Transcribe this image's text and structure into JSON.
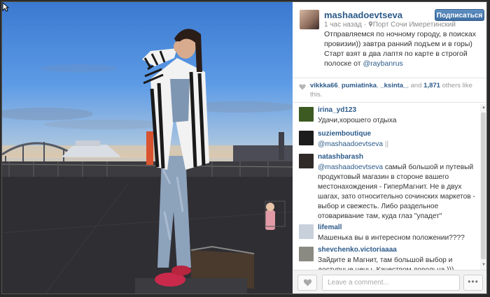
{
  "post": {
    "username": "mashaadoevtseva",
    "follow_label": "Подписаться",
    "time": "1 час назад",
    "separator": " · ",
    "location": "Порт Сочи Имеретинский",
    "caption_text": "Отправляемся по ночному городу, в поисках провизии)) завтра ранний подъем и в горы) Старт взят в два лаптя по карте в строгой полоске от ",
    "caption_mention": "@raybanrus"
  },
  "likes": {
    "users": [
      "vikkka66",
      "pumiatinka",
      "_ksinta_"
    ],
    "sep1": ", ",
    "sep2": ", ",
    "and_text": ", and ",
    "count": "1,871",
    "suffix": " others like this."
  },
  "comments": [
    {
      "user": "irina_yd123",
      "mention": "",
      "text": "Удачи,хорошего отдыха",
      "avatar_color": "#3d5a22"
    },
    {
      "user": "suziemboutique",
      "mention": "@mashaadoevtseva",
      "text": " ||",
      "avatar_color": "#1c1c1c"
    },
    {
      "user": "natashbarash",
      "mention": "@mashaadoevtseva",
      "text": " самый большой и путевый продуктовый магазин в стороне вашего местонахождения - ГиперМагнит. Не в двух шагах, зато относительно сочинских маркетов - выбор и свежесть. Либо раздельное отоваривание там, куда глаз \"упадет\"",
      "avatar_color": "#2f2a28"
    },
    {
      "user": "lifemall",
      "mention": "",
      "text": "Машенька вы в интересном положении????",
      "avatar_color": "#c8d0dc"
    },
    {
      "user": "shevchenko.victoriaaaa",
      "mention": "",
      "text": "Зайдите в Магнит, там большой выбор и доступные цены. Качеством довольна )))",
      "avatar_color": "#8a8a82"
    }
  ],
  "footer": {
    "comment_placeholder": "Leave a comment...",
    "more_label": "•••"
  },
  "icons": {
    "cursor": "cursor-arrow-icon",
    "location": "pin-icon",
    "heart": "heart-icon",
    "scroll_up": "▲",
    "scroll_down": "▼"
  },
  "colors": {
    "link_blue": "#2c5a8a",
    "follow_button": "#4a7ab0"
  }
}
